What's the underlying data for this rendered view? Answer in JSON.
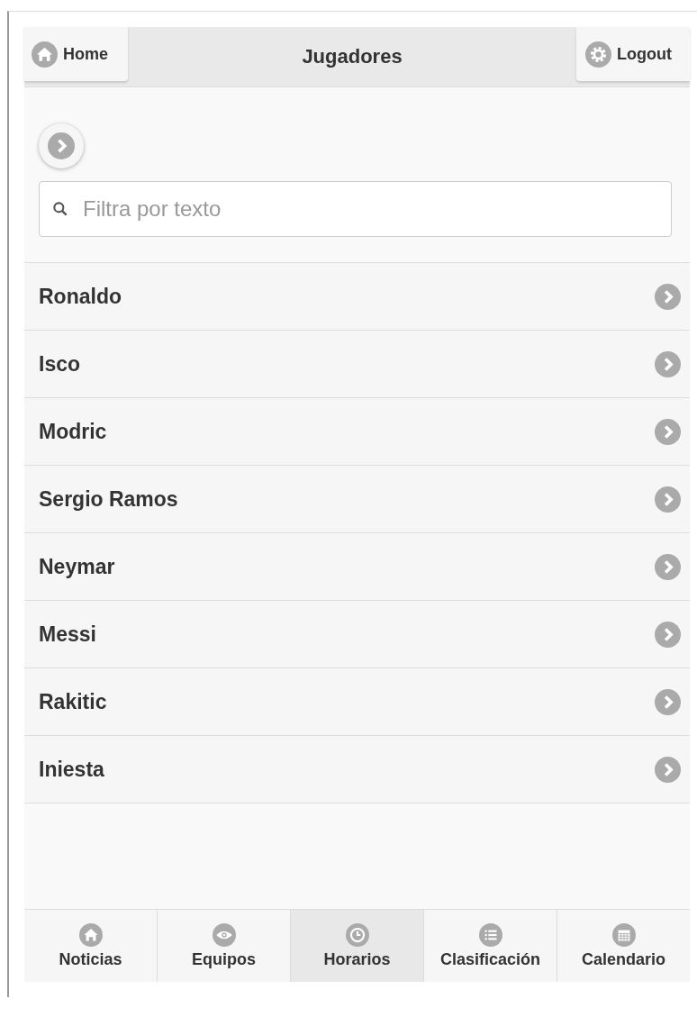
{
  "header": {
    "title": "Jugadores",
    "left_button": {
      "label": "Home",
      "kind": "home"
    },
    "right_button": {
      "label": "Logout",
      "kind": "gear"
    }
  },
  "search": {
    "placeholder": "Filtra por texto"
  },
  "players": [
    {
      "name": "Ronaldo"
    },
    {
      "name": "Isco"
    },
    {
      "name": "Modric"
    },
    {
      "name": "Sergio Ramos"
    },
    {
      "name": "Neymar"
    },
    {
      "name": "Messi"
    },
    {
      "name": "Rakitic"
    },
    {
      "name": "Iniesta"
    }
  ],
  "navbar": [
    {
      "label": "Noticias",
      "kind": "home",
      "selected": false
    },
    {
      "label": "Equipos",
      "kind": "eye",
      "selected": false
    },
    {
      "label": "Horarios",
      "kind": "clock",
      "selected": true
    },
    {
      "label": "Clasificación",
      "kind": "list",
      "selected": false
    },
    {
      "label": "Calendario",
      "kind": "calendar",
      "selected": false
    }
  ]
}
